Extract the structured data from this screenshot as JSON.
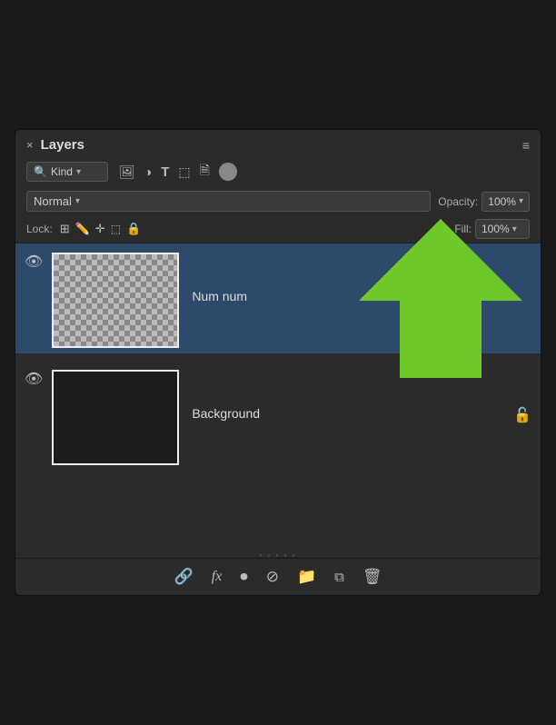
{
  "panel": {
    "title": "Layers",
    "close_label": "×",
    "expand_label": "»",
    "menu_label": "≡"
  },
  "toolbar": {
    "kind_label": "Kind",
    "kind_dropdown_arrow": "▾",
    "opacity_label": "Opacity:",
    "opacity_value": "100%",
    "blend_mode": "Normal",
    "fill_label": "Fill:",
    "fill_value": "100%"
  },
  "lock": {
    "label": "Lock:"
  },
  "layers": [
    {
      "name": "Num num",
      "visible": true,
      "selected": true,
      "type": "transparent",
      "locked": false,
      "has_arrow": true
    },
    {
      "name": "Background",
      "visible": true,
      "selected": false,
      "type": "dark",
      "locked": true,
      "has_arrow": false
    }
  ],
  "bottom_bar": {
    "link_icon": "🔗",
    "fx_label": "fx",
    "circle_icon": "⏺",
    "slash_icon": "⊘",
    "folder_icon": "🗂",
    "new_icon": "⧉",
    "trash_icon": "🗑"
  },
  "colors": {
    "selected_bg": "#2d4a6b",
    "panel_bg": "#2b2b2b",
    "arrow_green": "#6ec82a"
  }
}
